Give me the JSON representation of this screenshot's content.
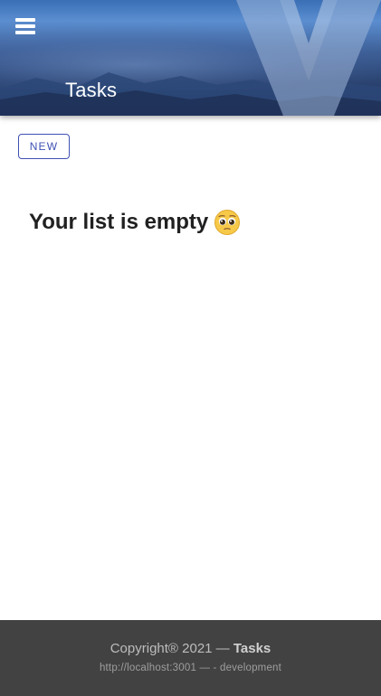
{
  "app_bar": {
    "title": "Tasks",
    "menu_icon": "hamburger-menu-icon",
    "logo_icon": "vuetify-v-logo-icon"
  },
  "toolbar": {
    "new_label": "NEW"
  },
  "main": {
    "empty_message": "Your list is empty",
    "empty_emoji_icon": "pleading-face-icon"
  },
  "footer": {
    "copyright_prefix": "Copyright® 2021 —",
    "app_name": "Tasks",
    "env_line": "http://localhost:3001 — - development"
  },
  "colors": {
    "primary": "#3f51b5",
    "footer_bg": "#424242"
  }
}
